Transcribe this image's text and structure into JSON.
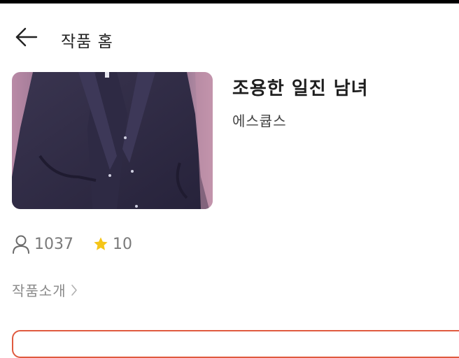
{
  "header": {
    "title": "작품 홈"
  },
  "work": {
    "title": "조용한 일진 남녀",
    "author": "에스큡스"
  },
  "stats": {
    "views": "1037",
    "rating": "10"
  },
  "intro": {
    "label": "작품소개"
  },
  "icons": {
    "back": "back-arrow-icon",
    "views": "user-icon",
    "rating": "star-icon",
    "intro": "chevron-right-icon"
  },
  "colors": {
    "star": "#f5c518",
    "card_border": "#e05a3f"
  }
}
